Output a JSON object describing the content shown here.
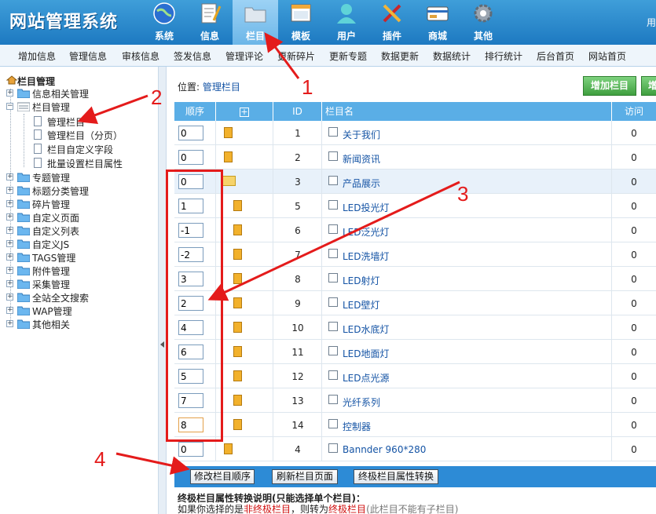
{
  "app_title": "网站管理系统",
  "user_text": "用",
  "nav": [
    {
      "label": "系统",
      "icon": "globe-icon"
    },
    {
      "label": "信息",
      "icon": "document-edit-icon"
    },
    {
      "label": "栏目",
      "icon": "folder-icon"
    },
    {
      "label": "模板",
      "icon": "template-window-icon"
    },
    {
      "label": "用户",
      "icon": "user-icon"
    },
    {
      "label": "插件",
      "icon": "tools-icon"
    },
    {
      "label": "商城",
      "icon": "credit-card-icon"
    },
    {
      "label": "其他",
      "icon": "gear-icon"
    }
  ],
  "active_nav": "栏目",
  "subnav": [
    "增加信息",
    "管理信息",
    "审核信息",
    "签发信息",
    "管理评论",
    "更新碎片",
    "更新专题",
    "数据更新",
    "数据统计",
    "排行统计",
    "后台首页",
    "网站首页"
  ],
  "sidebar": {
    "title": "栏目管理",
    "items": [
      {
        "label": "信息相关管理"
      },
      {
        "label": "栏目管理"
      },
      {
        "label": "管理栏目"
      },
      {
        "label": "管理栏目（分页）"
      },
      {
        "label": "栏目自定义字段"
      },
      {
        "label": "批量设置栏目属性"
      },
      {
        "label": "专题管理"
      },
      {
        "label": "标题分类管理"
      },
      {
        "label": "碎片管理"
      },
      {
        "label": "自定义页面"
      },
      {
        "label": "自定义列表"
      },
      {
        "label": "自定义JS"
      },
      {
        "label": "TAGS管理"
      },
      {
        "label": "附件管理"
      },
      {
        "label": "采集管理"
      },
      {
        "label": "全站全文搜索"
      },
      {
        "label": "WAP管理"
      },
      {
        "label": "其他相关"
      }
    ]
  },
  "location": {
    "prefix": "位置:",
    "link": "管理栏目"
  },
  "buttons": {
    "add_column": "增加栏目",
    "add_column_2": "增"
  },
  "table": {
    "headers": {
      "order": "顺序",
      "expand": "+",
      "id": "ID",
      "name": "栏目名",
      "visits": "访问"
    },
    "rows": [
      {
        "order": "0",
        "id": "1",
        "name": "关于我们",
        "visits": "0"
      },
      {
        "order": "0",
        "id": "2",
        "name": "新闻资讯",
        "visits": "0"
      },
      {
        "order": "0",
        "id": "3",
        "name": "产品展示",
        "visits": "0"
      },
      {
        "order": "1",
        "id": "5",
        "name": "LED投光灯",
        "visits": "0"
      },
      {
        "order": "-1",
        "id": "6",
        "name": "LED泛光灯",
        "visits": "0"
      },
      {
        "order": "-2",
        "id": "7",
        "name": "LED洗墙灯",
        "visits": "0"
      },
      {
        "order": "3",
        "id": "8",
        "name": "LED射灯",
        "visits": "0"
      },
      {
        "order": "2",
        "id": "9",
        "name": "LED壁灯",
        "visits": "0"
      },
      {
        "order": "4",
        "id": "10",
        "name": "LED水底灯",
        "visits": "0"
      },
      {
        "order": "6",
        "id": "11",
        "name": "LED地面灯",
        "visits": "0"
      },
      {
        "order": "5",
        "id": "12",
        "name": "LED点光源",
        "visits": "0"
      },
      {
        "order": "7",
        "id": "13",
        "name": "光纤系列",
        "visits": "0"
      },
      {
        "order": "8",
        "id": "14",
        "name": "控制器",
        "visits": "0"
      },
      {
        "order": "0",
        "id": "4",
        "name": "Bannder 960*280",
        "visits": "0"
      }
    ]
  },
  "actions": {
    "modify_order": "修改栏目顺序",
    "refresh_pages": "刷新栏目页面",
    "convert_terminal": "终极栏目属性转换"
  },
  "note": {
    "title": "终极栏目属性转换说明(只能选择单个栏目)：",
    "text_1": "如果你选择的是",
    "red_1": "非终极栏目",
    "text_2": "，则转为",
    "red_2": "终极栏目",
    "gray": "(此栏目不能有子栏目)"
  },
  "annotations": [
    "1",
    "2",
    "3",
    "4"
  ],
  "colors": {
    "header": "#2a89cf",
    "annotation": "#e41b1b",
    "accent_green": "#4caf50"
  }
}
